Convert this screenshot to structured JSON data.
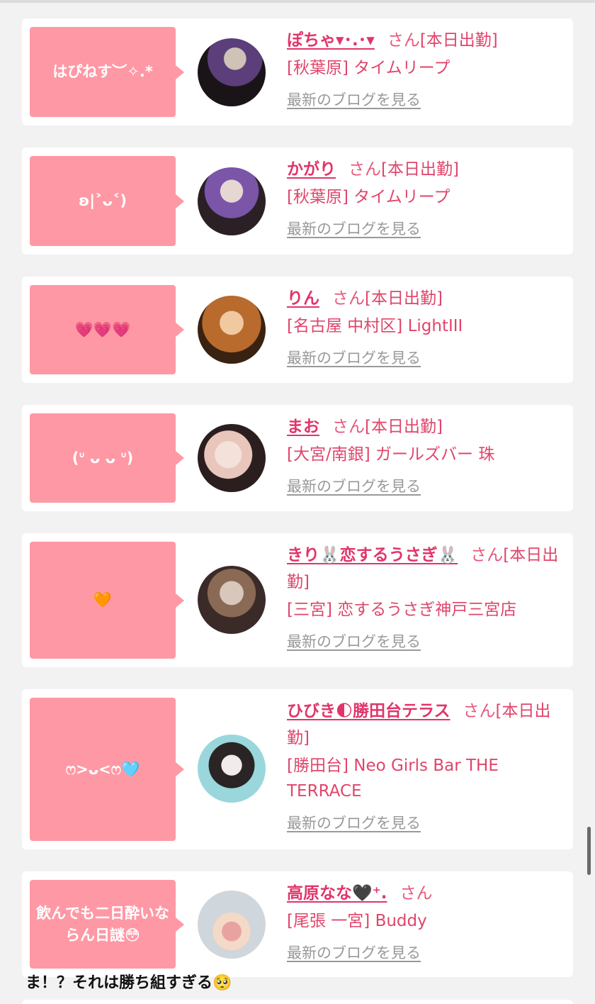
{
  "blog_link_label": "最新のブログを見る",
  "san_label": "さん",
  "entries": [
    {
      "message": "はぴねす︶✧.*",
      "name": "ぽちゃ▾･.･▾",
      "status": "[本日出勤]",
      "shop": "[秋葉原] タイムリープ",
      "avatar_colors": [
        "#1a1418",
        "#5b3e7a",
        "#cfc2b6"
      ]
    },
    {
      "message": "ʚ|˃ᴗ˂)",
      "name": "かがり",
      "status": "[本日出勤]",
      "shop": "[秋葉原] タイムリープ",
      "avatar_colors": [
        "#2a2026",
        "#7a55a8",
        "#e7d7d2"
      ]
    },
    {
      "message": "💗💗💗",
      "name": "りん",
      "status": "[本日出勤]",
      "shop": "[名古屋 中村区] LightIII",
      "avatar_colors": [
        "#3a2212",
        "#b86b2d",
        "#f0c9a0"
      ]
    },
    {
      "message": "(ᐡ ᴗ ᴗ ᐡ)",
      "name": "まお",
      "status": "[本日出勤]",
      "shop": "[大宮/南銀] ガールズバー 珠",
      "avatar_colors": [
        "#2b1e1e",
        "#e9c6bc",
        "#f4e2da"
      ]
    },
    {
      "message": "🧡",
      "name": "きり🐰恋するうさぎ🐰",
      "status": "[本日出勤]",
      "shop": "[三宮] 恋するうさぎ神戸三宮店",
      "avatar_colors": [
        "#3a2a28",
        "#d8c8bb",
        "#8a6a55"
      ]
    },
    {
      "message": "ෆ>ᴗ<ෆ🩵",
      "name": "ひびき🌓勝田台テラス",
      "status": "[本日出勤]",
      "shop": "[勝田台] Neo Girls Bar THE TERRACE",
      "avatar_colors": [
        "#9ad7dc",
        "#2a2424",
        "#f1eceb"
      ]
    },
    {
      "message": "飲んでも二日酔いならん日謎😳",
      "name": "高原なな🖤⁺.",
      "status": "",
      "shop": "[尾張 一宮] Buddy",
      "avatar_colors": [
        "#cfd6dc",
        "#f4d9c6",
        "#e8a3a0"
      ]
    }
  ],
  "comment": "ま！？それは勝ち組すぎる🥺"
}
